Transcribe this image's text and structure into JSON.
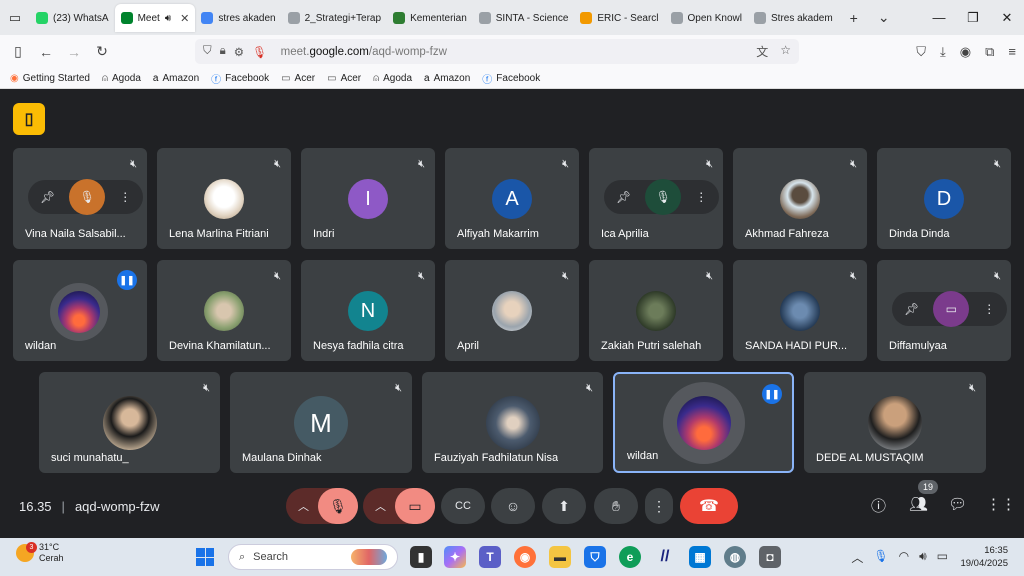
{
  "browser": {
    "tabs": [
      {
        "label": "(23) WhatsA",
        "icon": "whatsapp-icon",
        "color": "#25d366",
        "active": false
      },
      {
        "label": "Meet",
        "icon": "meet-icon",
        "color": "#00832d",
        "active": true
      },
      {
        "label": "stres akaden",
        "icon": "gemini-icon",
        "color": "#4285f4",
        "active": false
      },
      {
        "label": "2_Strategi+Terap",
        "icon": "document-icon",
        "color": "#9aa0a6",
        "active": false
      },
      {
        "label": "Kementerian",
        "icon": "garuda-icon",
        "color": "#2e7d32",
        "active": false
      },
      {
        "label": "SINTA - Science",
        "icon": "sinta-icon",
        "color": "#9aa0a6",
        "active": false
      },
      {
        "label": "ERIC - Searcl",
        "icon": "eric-icon",
        "color": "#f29900",
        "active": false
      },
      {
        "label": "Open Knowl",
        "icon": "pin-icon",
        "color": "#9aa0a6",
        "active": false
      },
      {
        "label": "Stres akadem",
        "icon": "pin-icon",
        "color": "#9aa0a6",
        "active": false
      }
    ],
    "url_prefix": "meet.",
    "url_domain": "google.com",
    "url_path": "/aqd-womp-fzw",
    "bookmarks": [
      {
        "label": "Getting Started",
        "icon": "firefox-icon"
      },
      {
        "label": "Agoda",
        "icon": "agoda-icon"
      },
      {
        "label": "Amazon",
        "icon": "amazon-icon"
      },
      {
        "label": "Facebook",
        "icon": "facebook-icon"
      },
      {
        "label": "Acer",
        "icon": "folder-icon"
      },
      {
        "label": "Acer",
        "icon": "folder-icon"
      },
      {
        "label": "Agoda",
        "icon": "agoda-icon"
      },
      {
        "label": "Amazon",
        "icon": "amazon-icon"
      },
      {
        "label": "Facebook",
        "icon": "facebook-icon"
      }
    ]
  },
  "meet": {
    "participants": {
      "vina": {
        "name": "Vina Naila Salsabil...",
        "avatar_color": "#c9722b"
      },
      "lena": {
        "name": "Lena Marlina Fitriani"
      },
      "indri": {
        "name": "Indri",
        "initial": "I",
        "avatar_color": "#8e59c6"
      },
      "alfiyah": {
        "name": "Alfiyah Makarrim",
        "initial": "A",
        "avatar_color": "#1a56a8"
      },
      "ica": {
        "name": "Ica Aprilia",
        "avatar_color": "#1e4d3a"
      },
      "akhmad": {
        "name": "Akhmad Fahreza"
      },
      "dinda": {
        "name": "Dinda Dinda",
        "initial": "D",
        "avatar_color": "#1a56a8"
      },
      "wildan1": {
        "name": "wildan"
      },
      "devina": {
        "name": "Devina Khamilatun..."
      },
      "nesya": {
        "name": "Nesya fadhila citra",
        "initial": "N",
        "avatar_color": "#12848f"
      },
      "april": {
        "name": "April"
      },
      "zakiah": {
        "name": "Zakiah Putri salehah"
      },
      "sanda": {
        "name": "SANDA HADI PUR..."
      },
      "diffa": {
        "name": "Diffamulyaa",
        "avatar_color": "#7b3b8c"
      },
      "suci": {
        "name": "suci munahatu_"
      },
      "maulana": {
        "name": "Maulana Dinhak",
        "initial": "M",
        "avatar_color": "#455a64"
      },
      "fauziyah": {
        "name": "Fauziyah Fadhilatun Nisa"
      },
      "wildan2": {
        "name": "wildan"
      },
      "dede": {
        "name": "DEDE AL MUSTAQIM"
      }
    },
    "time": "16.35",
    "meeting_code": "aqd-womp-fzw",
    "participant_count": "19",
    "accent_host": "#fbbc04",
    "accent_leave": "#ea4335"
  },
  "taskbar": {
    "weather_temp": "31°C",
    "weather_desc": "Cerah",
    "weather_badge": "3",
    "search_placeholder": "Search",
    "clock_time": "16:35",
    "clock_date": "19/04/2025"
  }
}
